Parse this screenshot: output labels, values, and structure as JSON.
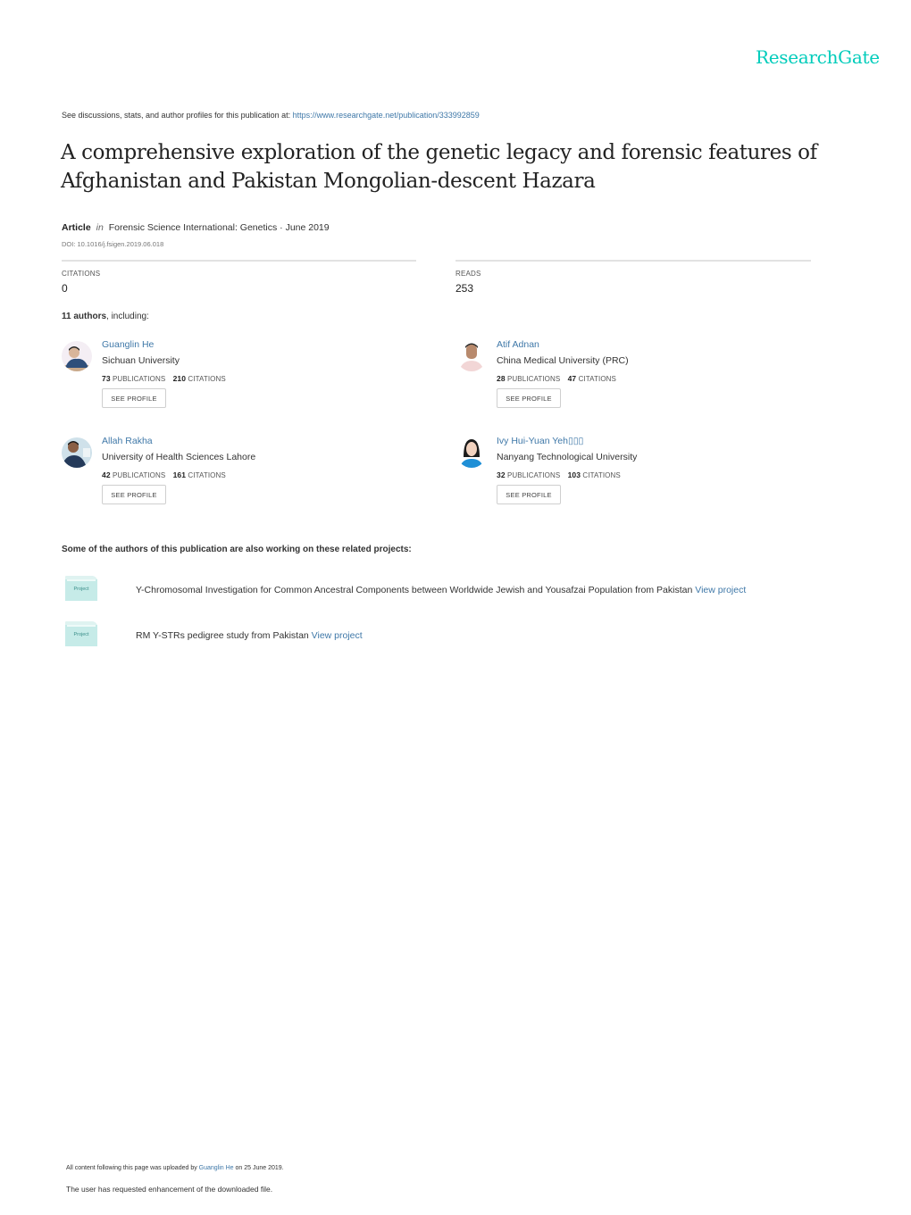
{
  "header": {
    "logo": "ResearchGate",
    "see_discussions": "See discussions, stats, and author profiles for this publication at: ",
    "publication_url": "https://www.researchgate.net/publication/333992859"
  },
  "publication": {
    "title": "A comprehensive exploration of the genetic legacy and forensic features of Afghanistan and Pakistan Mongolian-descent Hazara",
    "type": "Article",
    "in": "in",
    "journal": "Forensic Science International: Genetics · June 2019",
    "doi": "DOI: 10.1016/j.fsigen.2019.06.018"
  },
  "stats": {
    "citations_label": "CITATIONS",
    "citations_value": "0",
    "reads_label": "READS",
    "reads_value": "253"
  },
  "authors_summary": {
    "count": "11 authors",
    "suffix": ", including:"
  },
  "authors": [
    {
      "name": "Guanglin He",
      "institution": "Sichuan University",
      "publications": "73",
      "citations": "210",
      "publications_label": "PUBLICATIONS",
      "citations_label": "CITATIONS",
      "button": "SEE PROFILE"
    },
    {
      "name": "Atif Adnan",
      "institution": "China Medical University (PRC)",
      "publications": "28",
      "citations": "47",
      "publications_label": "PUBLICATIONS",
      "citations_label": "CITATIONS",
      "button": "SEE PROFILE"
    },
    {
      "name": "Allah Rakha",
      "institution": "University of Health Sciences Lahore",
      "publications": "42",
      "citations": "161",
      "publications_label": "PUBLICATIONS",
      "citations_label": "CITATIONS",
      "button": "SEE PROFILE"
    },
    {
      "name": "Ivy Hui-Yuan Yeh▯▯▯",
      "institution": "Nanyang Technological University",
      "publications": "32",
      "citations": "103",
      "publications_label": "PUBLICATIONS",
      "citations_label": "CITATIONS",
      "button": "SEE PROFILE"
    }
  ],
  "related": {
    "heading": "Some of the authors of this publication are also working on these related projects:",
    "projects": [
      {
        "icon_label": "Project",
        "title": "Y-Chromosomal Investigation for Common Ancestral Components between Worldwide Jewish and Yousafzai Population from Pakistan ",
        "link": "View project"
      },
      {
        "icon_label": "Project",
        "title": "RM Y-STRs pedigree study from Pakistan ",
        "link": "View project"
      }
    ]
  },
  "footer": {
    "uploaded_prefix": "All content following this page was uploaded by ",
    "uploaded_by": "Guanglin He",
    "uploaded_suffix": " on 25 June 2019.",
    "enhancement": "The user has requested enhancement of the downloaded file."
  },
  "colors": {
    "brand": "#00ccbb",
    "link": "#3f78a8"
  }
}
